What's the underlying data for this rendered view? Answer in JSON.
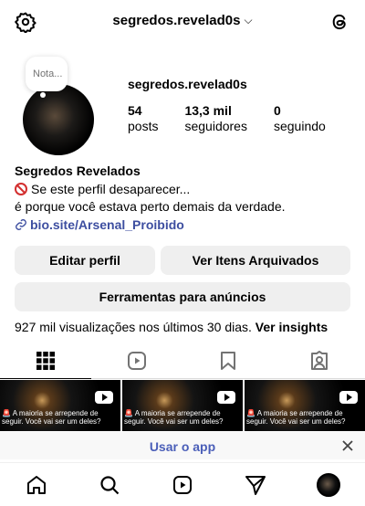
{
  "header": {
    "username": "segredos.revelad0s",
    "chevron": "⌵",
    "settings_icon": "settings-icon",
    "threads_icon": "threads-icon"
  },
  "note": {
    "text": "Nota..."
  },
  "profile": {
    "name": "segredos.revelad0s",
    "stats": [
      {
        "value": "54",
        "label": "posts"
      },
      {
        "value": "13,3 mil",
        "label": "seguidores"
      },
      {
        "value": "0",
        "label": "seguindo"
      }
    ]
  },
  "bio": {
    "full_name": "Segredos Revelados",
    "line1": "Se este perfil desaparecer...",
    "line2": "é porque você estava perto demais da verdade.",
    "link": "bio.site/Arsenal_Proibido"
  },
  "buttons": {
    "edit": "Editar perfil",
    "archive": "Ver Itens Arquivados",
    "tools": "Ferramentas para anúncios"
  },
  "insights": {
    "text": "927 mil visualizações nos últimos 30 dias.",
    "link": "Ver insights"
  },
  "tabs": [
    "posts-grid",
    "reels",
    "saved",
    "tagged"
  ],
  "posts": [
    {
      "caption": "🚨 A maioria se arrepende de seguir. Você vai ser um deles?"
    },
    {
      "caption": "🚨 A maioria se arrepende de seguir. Você vai ser um deles?"
    },
    {
      "caption": "🚨 A maioria se arrepende de seguir. Você vai ser um deles?"
    }
  ],
  "open_app": {
    "label": "Usar o app"
  },
  "bottom_nav": [
    "home",
    "search",
    "reels",
    "messages",
    "profile"
  ],
  "colors": {
    "link": "#3d4ea0",
    "button_bg": "#efefef",
    "danger": "#d32f2f"
  }
}
